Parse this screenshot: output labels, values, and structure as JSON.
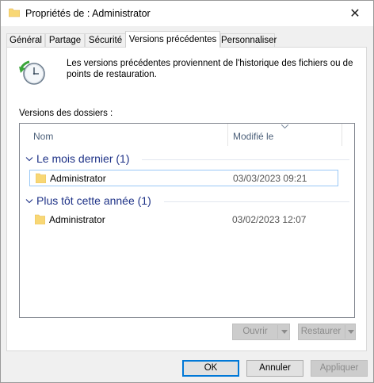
{
  "window": {
    "title": "Propriétés de : Administrator",
    "close_glyph": "✕"
  },
  "tabs": [
    {
      "label": "Général",
      "active": false
    },
    {
      "label": "Partage",
      "active": false
    },
    {
      "label": "Sécurité",
      "active": false
    },
    {
      "label": "Versions précédentes",
      "active": true
    },
    {
      "label": "Personnaliser",
      "active": false
    }
  ],
  "info": {
    "text": "Les versions précédentes proviennent de l'historique des fichiers ou de points de restauration.",
    "icon": "restore-clock-icon"
  },
  "versions": {
    "label": "Versions des dossiers :",
    "columns": {
      "name": "Nom",
      "modified": "Modifié le"
    },
    "groups": [
      {
        "title": "Le mois dernier (1)",
        "items": [
          {
            "name": "Administrator",
            "modified": "03/03/2023 09:21",
            "selected": true
          }
        ]
      },
      {
        "title": "Plus tôt cette année (1)",
        "items": [
          {
            "name": "Administrator",
            "modified": "03/02/2023 12:07",
            "selected": false
          }
        ]
      }
    ]
  },
  "actions": {
    "open": "Ouvrir",
    "restore": "Restaurer"
  },
  "footer": {
    "ok": "OK",
    "cancel": "Annuler",
    "apply": "Appliquer"
  },
  "colors": {
    "group_title": "#1e3287",
    "selection_border": "#99c8f6",
    "default_button": "#0078d7"
  }
}
